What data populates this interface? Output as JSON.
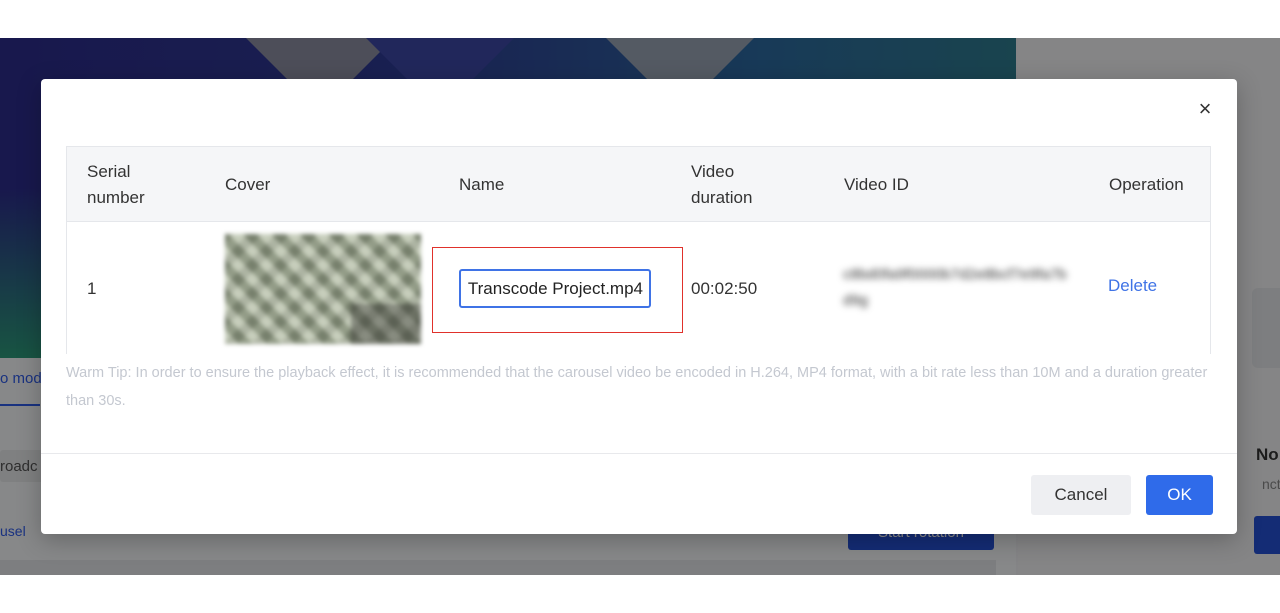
{
  "background": {
    "tab_text": "o mod",
    "select_text": "roadc",
    "link_text": "usel",
    "start_button": "Start rotation",
    "right_title": "No",
    "right_subtitle": "nction"
  },
  "modal": {
    "close_icon": "×",
    "columns": {
      "serial": "Serial number",
      "cover": "Cover",
      "name": "Name",
      "duration": "Video duration",
      "video_id": "Video ID",
      "operation": "Operation"
    },
    "row": {
      "serial": "1",
      "name_value": "Transcode Project.mp4",
      "duration": "00:02:50",
      "video_id": "c8bd0fa9f0000b7d2e8bcf7e9fa7bd9g",
      "delete_label": "Delete"
    },
    "warm_tip": "Warm Tip: In order to ensure the playback effect, it is recommended that the carousel video be encoded in H.264, MP4 format, with a bit rate less than 10M and a duration greater than 30s.",
    "cancel_label": "Cancel",
    "ok_label": "OK"
  },
  "colors": {
    "primary": "#2f6bea",
    "highlight_border": "#e0312b"
  }
}
